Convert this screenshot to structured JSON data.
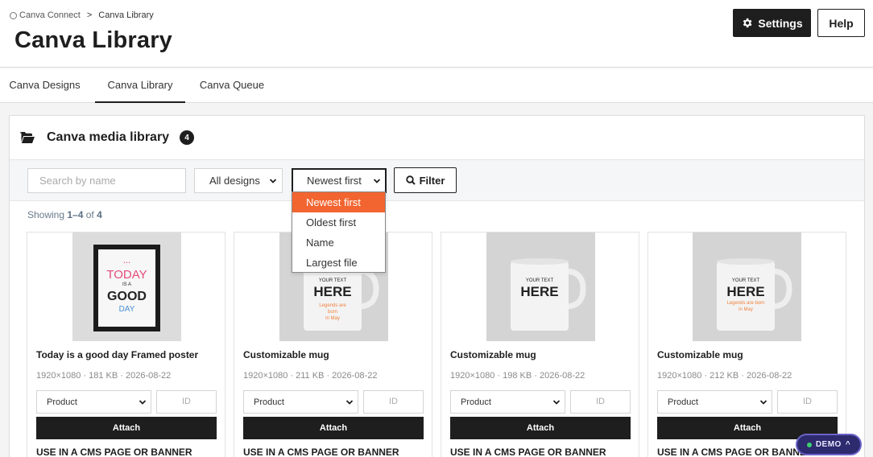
{
  "breadcrumb": {
    "root": "Canva Connect",
    "separator": ">",
    "current": "Canva Library"
  },
  "page": {
    "title": "Canva Library"
  },
  "header_buttons": {
    "settings": "Settings",
    "help": "Help"
  },
  "tabs": [
    {
      "label": "Canva Designs",
      "active": false
    },
    {
      "label": "Canva Library",
      "active": true
    },
    {
      "label": "Canva Queue",
      "active": false
    }
  ],
  "panel": {
    "title": "Canva media library",
    "count": "4"
  },
  "filters": {
    "search_placeholder": "Search by name",
    "type_select": "All designs",
    "sort_select": "Newest first",
    "filter_button": "Filter",
    "sort_options": [
      "Newest first",
      "Oldest first",
      "Name",
      "Largest file"
    ]
  },
  "showing": {
    "prefix": "Showing",
    "range": "1–4",
    "of": "of",
    "total": "4"
  },
  "cards": [
    {
      "title": "Today is a good day Framed poster",
      "meta": "1920×1080 · 181 KB · 2026-08-22",
      "product": "Product",
      "id_placeholder": "ID",
      "attach": "Attach",
      "use_label": "USE IN A CMS PAGE OR BANNER",
      "thumb_text": [
        "TODAY",
        "IS A",
        "GOOD",
        "DAY"
      ]
    },
    {
      "title": "Customizable mug",
      "meta": "1920×1080 · 211 KB · 2026-08-22",
      "product": "Product",
      "id_placeholder": "ID",
      "attach": "Attach",
      "use_label": "USE IN A CMS PAGE OR BANNER",
      "thumb_text": [
        "YOUR TEXT",
        "HERE",
        "Legends are",
        "born",
        "in May"
      ]
    },
    {
      "title": "Customizable mug",
      "meta": "1920×1080 · 198 KB · 2026-08-22",
      "product": "Product",
      "id_placeholder": "ID",
      "attach": "Attach",
      "use_label": "USE IN A CMS PAGE OR BANNER",
      "thumb_text": [
        "YOUR TEXT",
        "HERE"
      ]
    },
    {
      "title": "Customizable mug",
      "meta": "1920×1080 · 212 KB · 2026-08-22",
      "product": "Product",
      "id_placeholder": "ID",
      "attach": "Attach",
      "use_label": "USE IN A CMS PAGE OR BANNER",
      "thumb_text": [
        "YOUR TEXT",
        "HERE",
        "Legends are born",
        "in May"
      ]
    }
  ],
  "demo_badge": {
    "label": "DEMO",
    "chevron": "^"
  },
  "colors": {
    "primary": "#1e1e1e",
    "accent": "#f26531",
    "demo_bg": "#2d2a6e"
  },
  "icons": {
    "settings": "gear-icon",
    "filter": "search-icon",
    "panel": "folder-open-icon",
    "breadcrumb": "canva-icon"
  }
}
